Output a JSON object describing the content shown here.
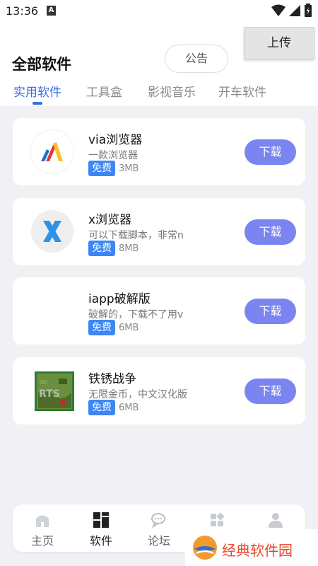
{
  "status_bar": {
    "time": "13:36",
    "notification": "A"
  },
  "header": {
    "title": "全部软件",
    "notice_label": "公告",
    "upload_label": "上传"
  },
  "tabs": [
    {
      "label": "实用软件",
      "active": true
    },
    {
      "label": "工具盒",
      "active": false
    },
    {
      "label": "影视音乐",
      "active": false
    },
    {
      "label": "开车软件",
      "active": false
    }
  ],
  "apps": [
    {
      "name": "via浏览器",
      "desc": "一款浏览器",
      "badge": "免费",
      "size": "3MB",
      "download_label": "下载",
      "icon": "via-logo-icon"
    },
    {
      "name": "x浏览器",
      "desc": "可以下载脚本，非常n",
      "badge": "免费",
      "size": "8MB",
      "download_label": "下载",
      "icon": "x-browser-logo-icon"
    },
    {
      "name": "iapp破解版",
      "desc": "破解的，下载不了用v",
      "badge": "免费",
      "size": "6MB",
      "download_label": "下载",
      "icon": "none"
    },
    {
      "name": "铁锈战争",
      "desc": "无限金币，中文汉化版",
      "badge": "免费",
      "size": "6MB",
      "download_label": "下载",
      "icon": "rusted-warfare-icon"
    }
  ],
  "bottom_nav": [
    {
      "label": "主页",
      "icon": "home-icon"
    },
    {
      "label": "软件",
      "icon": "grid-icon",
      "active": true
    },
    {
      "label": "论坛",
      "icon": "chat-icon"
    },
    {
      "label": "",
      "icon": "apps-icon"
    },
    {
      "label": "",
      "icon": "user-icon"
    }
  ],
  "watermark": {
    "text": "经典软件园"
  },
  "colors": {
    "accent": "#3b6fe0",
    "download": "#7b85f2",
    "badge": "#3d86f5",
    "watermark": "#e7472c"
  }
}
